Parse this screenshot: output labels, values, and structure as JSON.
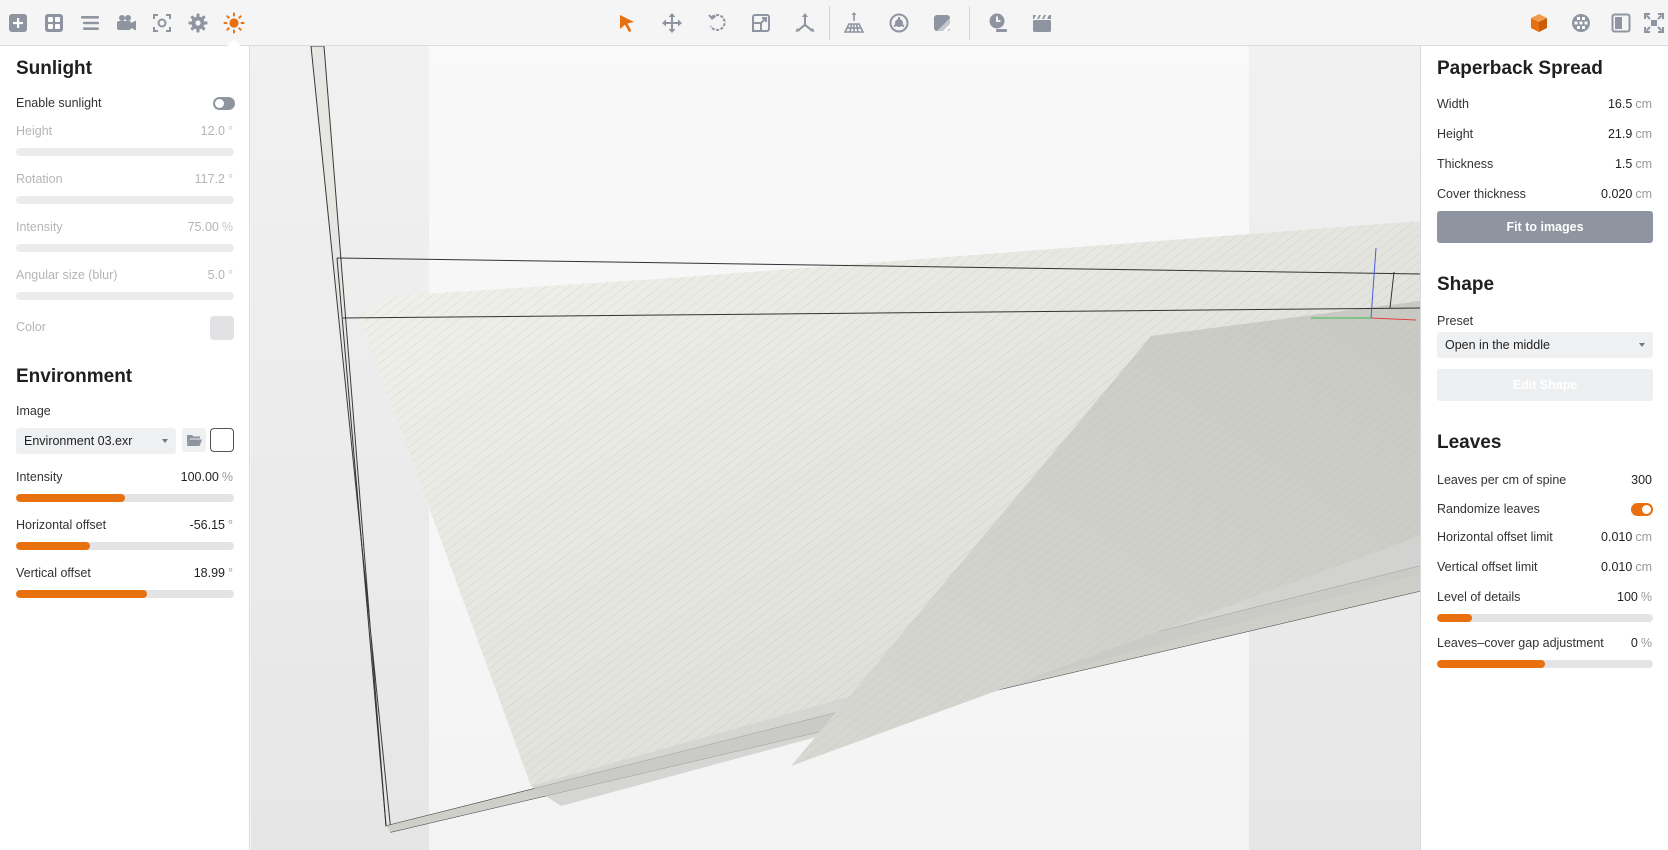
{
  "toolbar": {
    "left": [
      "add-icon",
      "grid-icon",
      "list-icon",
      "camera-icon",
      "focus-icon",
      "settings-icon",
      "sun-icon"
    ],
    "center": [
      "select-arrow-icon",
      "move-icon",
      "rotate-icon",
      "scale-icon",
      "axes-icon",
      "floor-icon",
      "material-icon",
      "texture-icon",
      "clock-icon",
      "clapper-icon"
    ],
    "right": [
      "cube-icon",
      "sphere-grid-icon",
      "frame-icon",
      "fullscreen-icon"
    ],
    "accent": "#e8700f",
    "icon_color": "#8e95a1"
  },
  "sunlight": {
    "title": "Sunlight",
    "enable_label": "Enable sunlight",
    "enabled": false,
    "height": {
      "label": "Height",
      "value": "12.0",
      "unit": "°",
      "fraction": 0.0
    },
    "rotation": {
      "label": "Rotation",
      "value": "117.2",
      "unit": "°",
      "fraction": 0.0
    },
    "intensity": {
      "label": "Intensity",
      "value": "75.00",
      "unit": "%",
      "fraction": 0.0
    },
    "angular": {
      "label": "Angular size (blur)",
      "value": "5.0",
      "unit": "°",
      "fraction": 0.0
    },
    "color_label": "Color"
  },
  "environment": {
    "title": "Environment",
    "image_label": "Image",
    "image_value": "Environment 03.exr",
    "intensity": {
      "label": "Intensity",
      "value": "100.00",
      "unit": "%",
      "fraction": 0.5
    },
    "h_offset": {
      "label": "Horizontal offset",
      "value": "-56.15",
      "unit": "°",
      "fraction": 0.34
    },
    "v_offset": {
      "label": "Vertical offset",
      "value": "18.99",
      "unit": "°",
      "fraction": 0.6
    }
  },
  "spread": {
    "title": "Paperback Spread",
    "width": {
      "label": "Width",
      "value": "16.5",
      "unit": "cm"
    },
    "height": {
      "label": "Height",
      "value": "21.9",
      "unit": "cm"
    },
    "thickness": {
      "label": "Thickness",
      "value": "1.5",
      "unit": "cm"
    },
    "cover": {
      "label": "Cover thickness",
      "value": "0.020",
      "unit": "cm"
    },
    "fit_button": "Fit to images"
  },
  "shape": {
    "title": "Shape",
    "preset_label": "Preset",
    "preset_value": "Open in the middle",
    "edit_button": "Edit Shape"
  },
  "leaves": {
    "title": "Leaves",
    "per_cm": {
      "label": "Leaves per cm of spine",
      "value": "300"
    },
    "randomize_label": "Randomize leaves",
    "randomize": true,
    "h_limit": {
      "label": "Horizontal offset limit",
      "value": "0.010",
      "unit": "cm"
    },
    "v_limit": {
      "label": "Vertical offset limit",
      "value": "0.010",
      "unit": "cm"
    },
    "lod": {
      "label": "Level of details",
      "value": "100",
      "unit": "%",
      "fraction": 0.16
    },
    "gap": {
      "label": "Leaves–cover gap adjustment",
      "value": "0",
      "unit": "%",
      "fraction": 0.5
    }
  }
}
